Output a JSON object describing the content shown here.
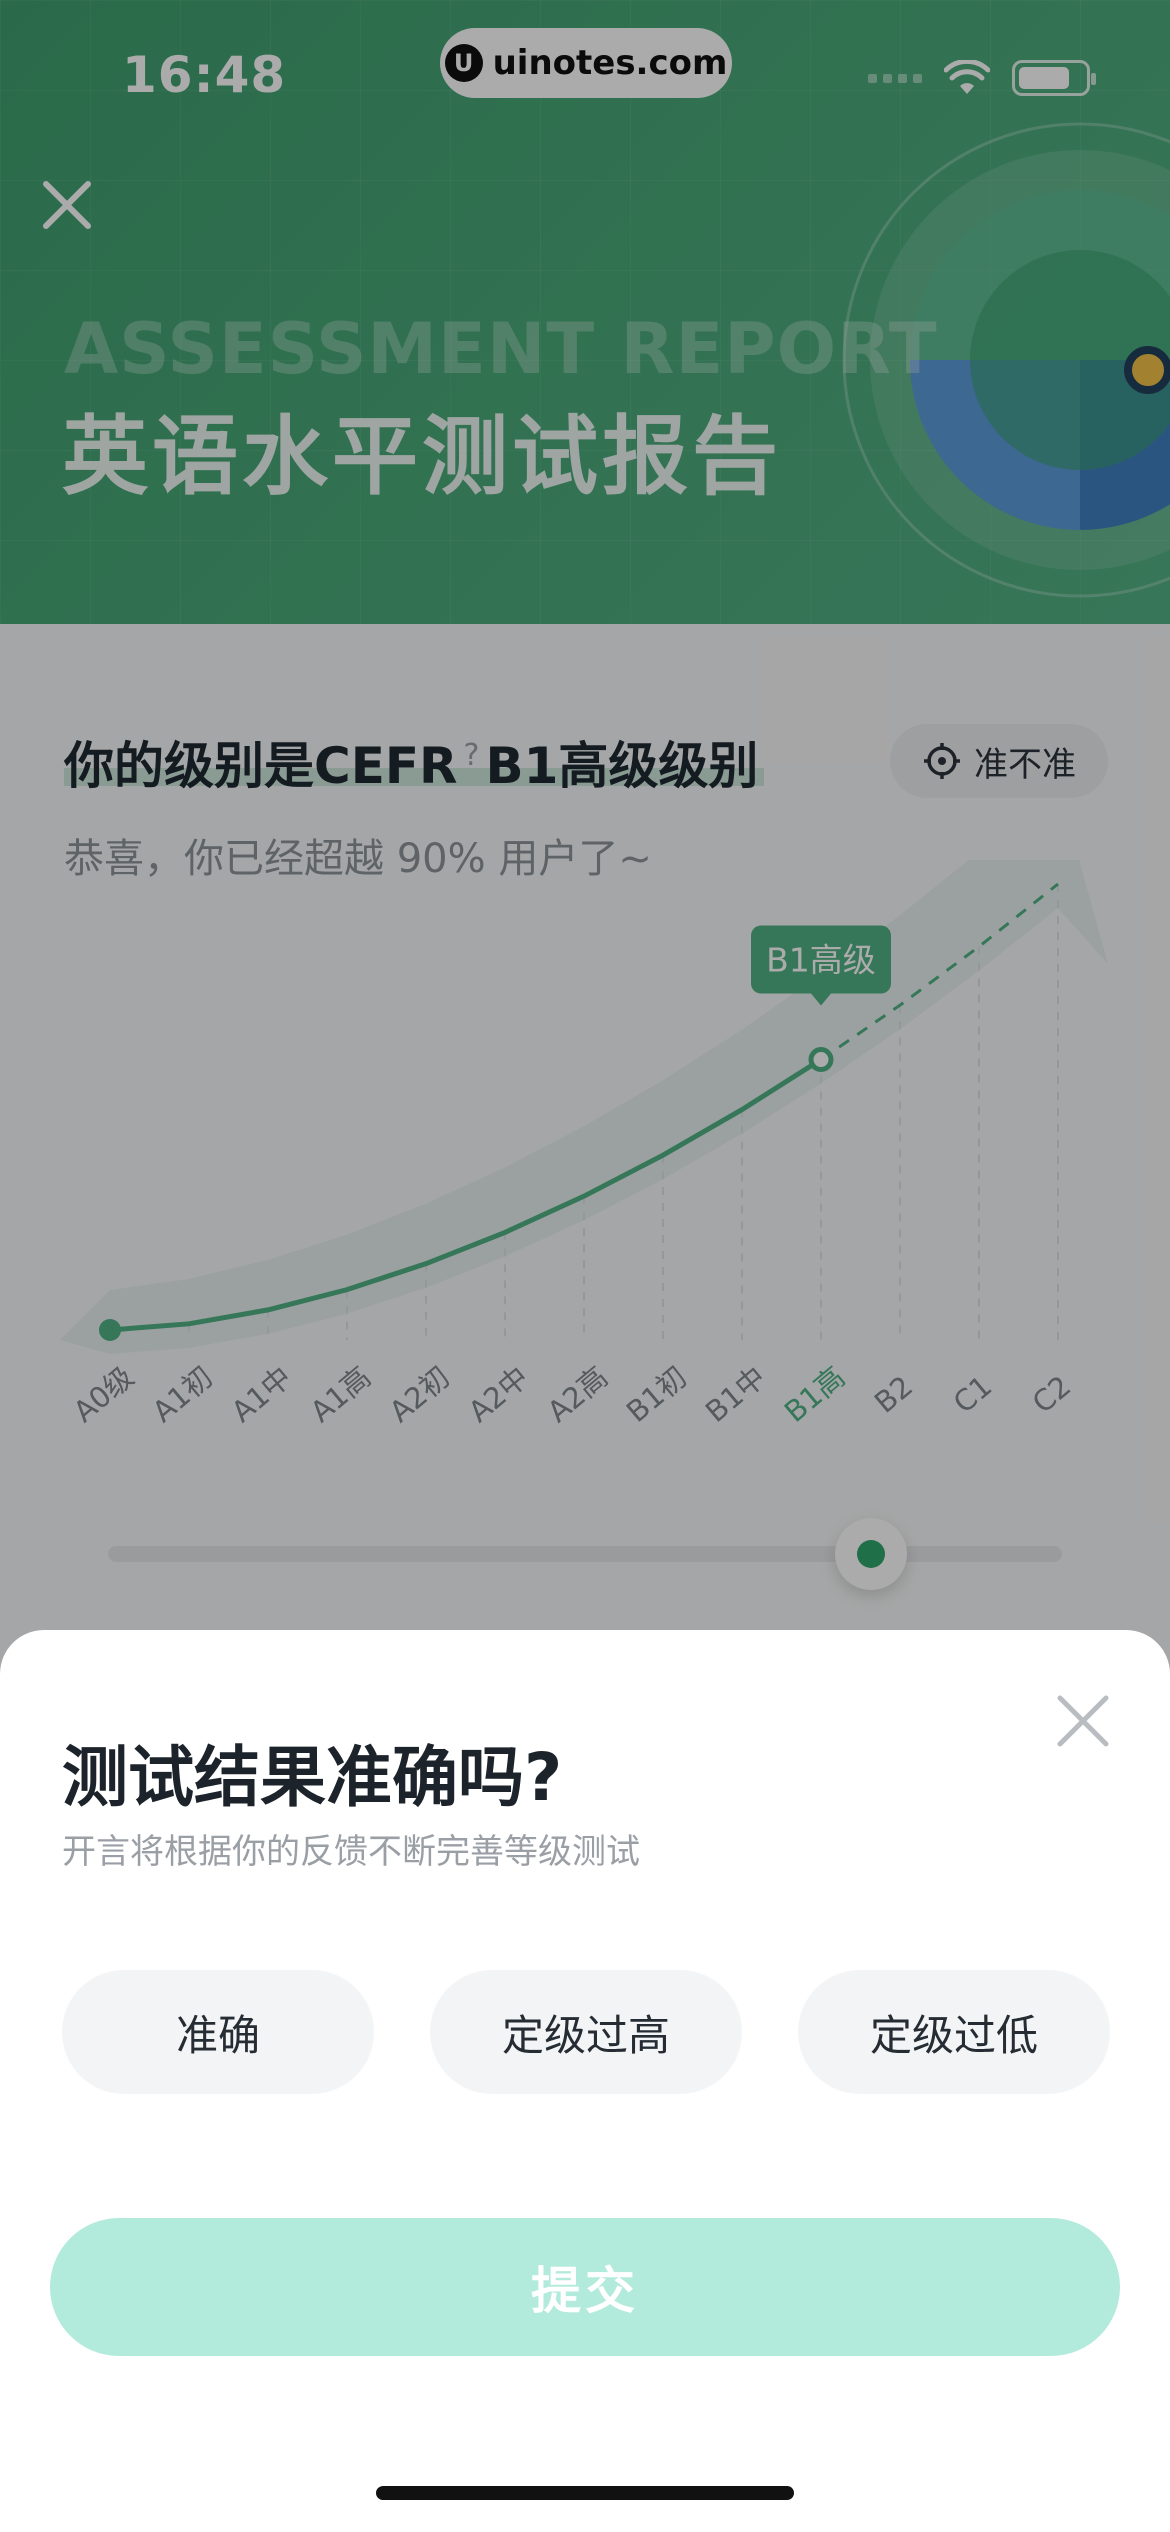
{
  "status_bar": {
    "time": "16:48",
    "url": "uinotes.com"
  },
  "header": {
    "title_en": "ASSESSMENT REPORT",
    "title_cn": "英语水平测试报告"
  },
  "report": {
    "level_prefix": "你的级别是CEFR",
    "level_value": "B1高级级别",
    "help_glyph": "?",
    "accuracy_button": "准不准",
    "subtitle": "恭喜，你已经超越 90% 用户了~",
    "current_level_label": "B1高级",
    "slider_position": 0.8
  },
  "chart_data": {
    "type": "line",
    "categories": [
      "A0级",
      "A1初",
      "A1中",
      "A1高",
      "A2初",
      "A2中",
      "A2高",
      "B1初",
      "B1中",
      "B1高",
      "B2",
      "C1",
      "C2"
    ],
    "current_index": 9,
    "highlight_color": "#4fb284",
    "line_color": "#4fb284"
  },
  "feedback": {
    "title": "测试结果准确吗?",
    "subtitle": "开言将根据你的反馈不断完善等级测试",
    "options": [
      "准确",
      "定级过高",
      "定级过低"
    ],
    "submit": "提交",
    "submit_color": "#b2eadb"
  }
}
